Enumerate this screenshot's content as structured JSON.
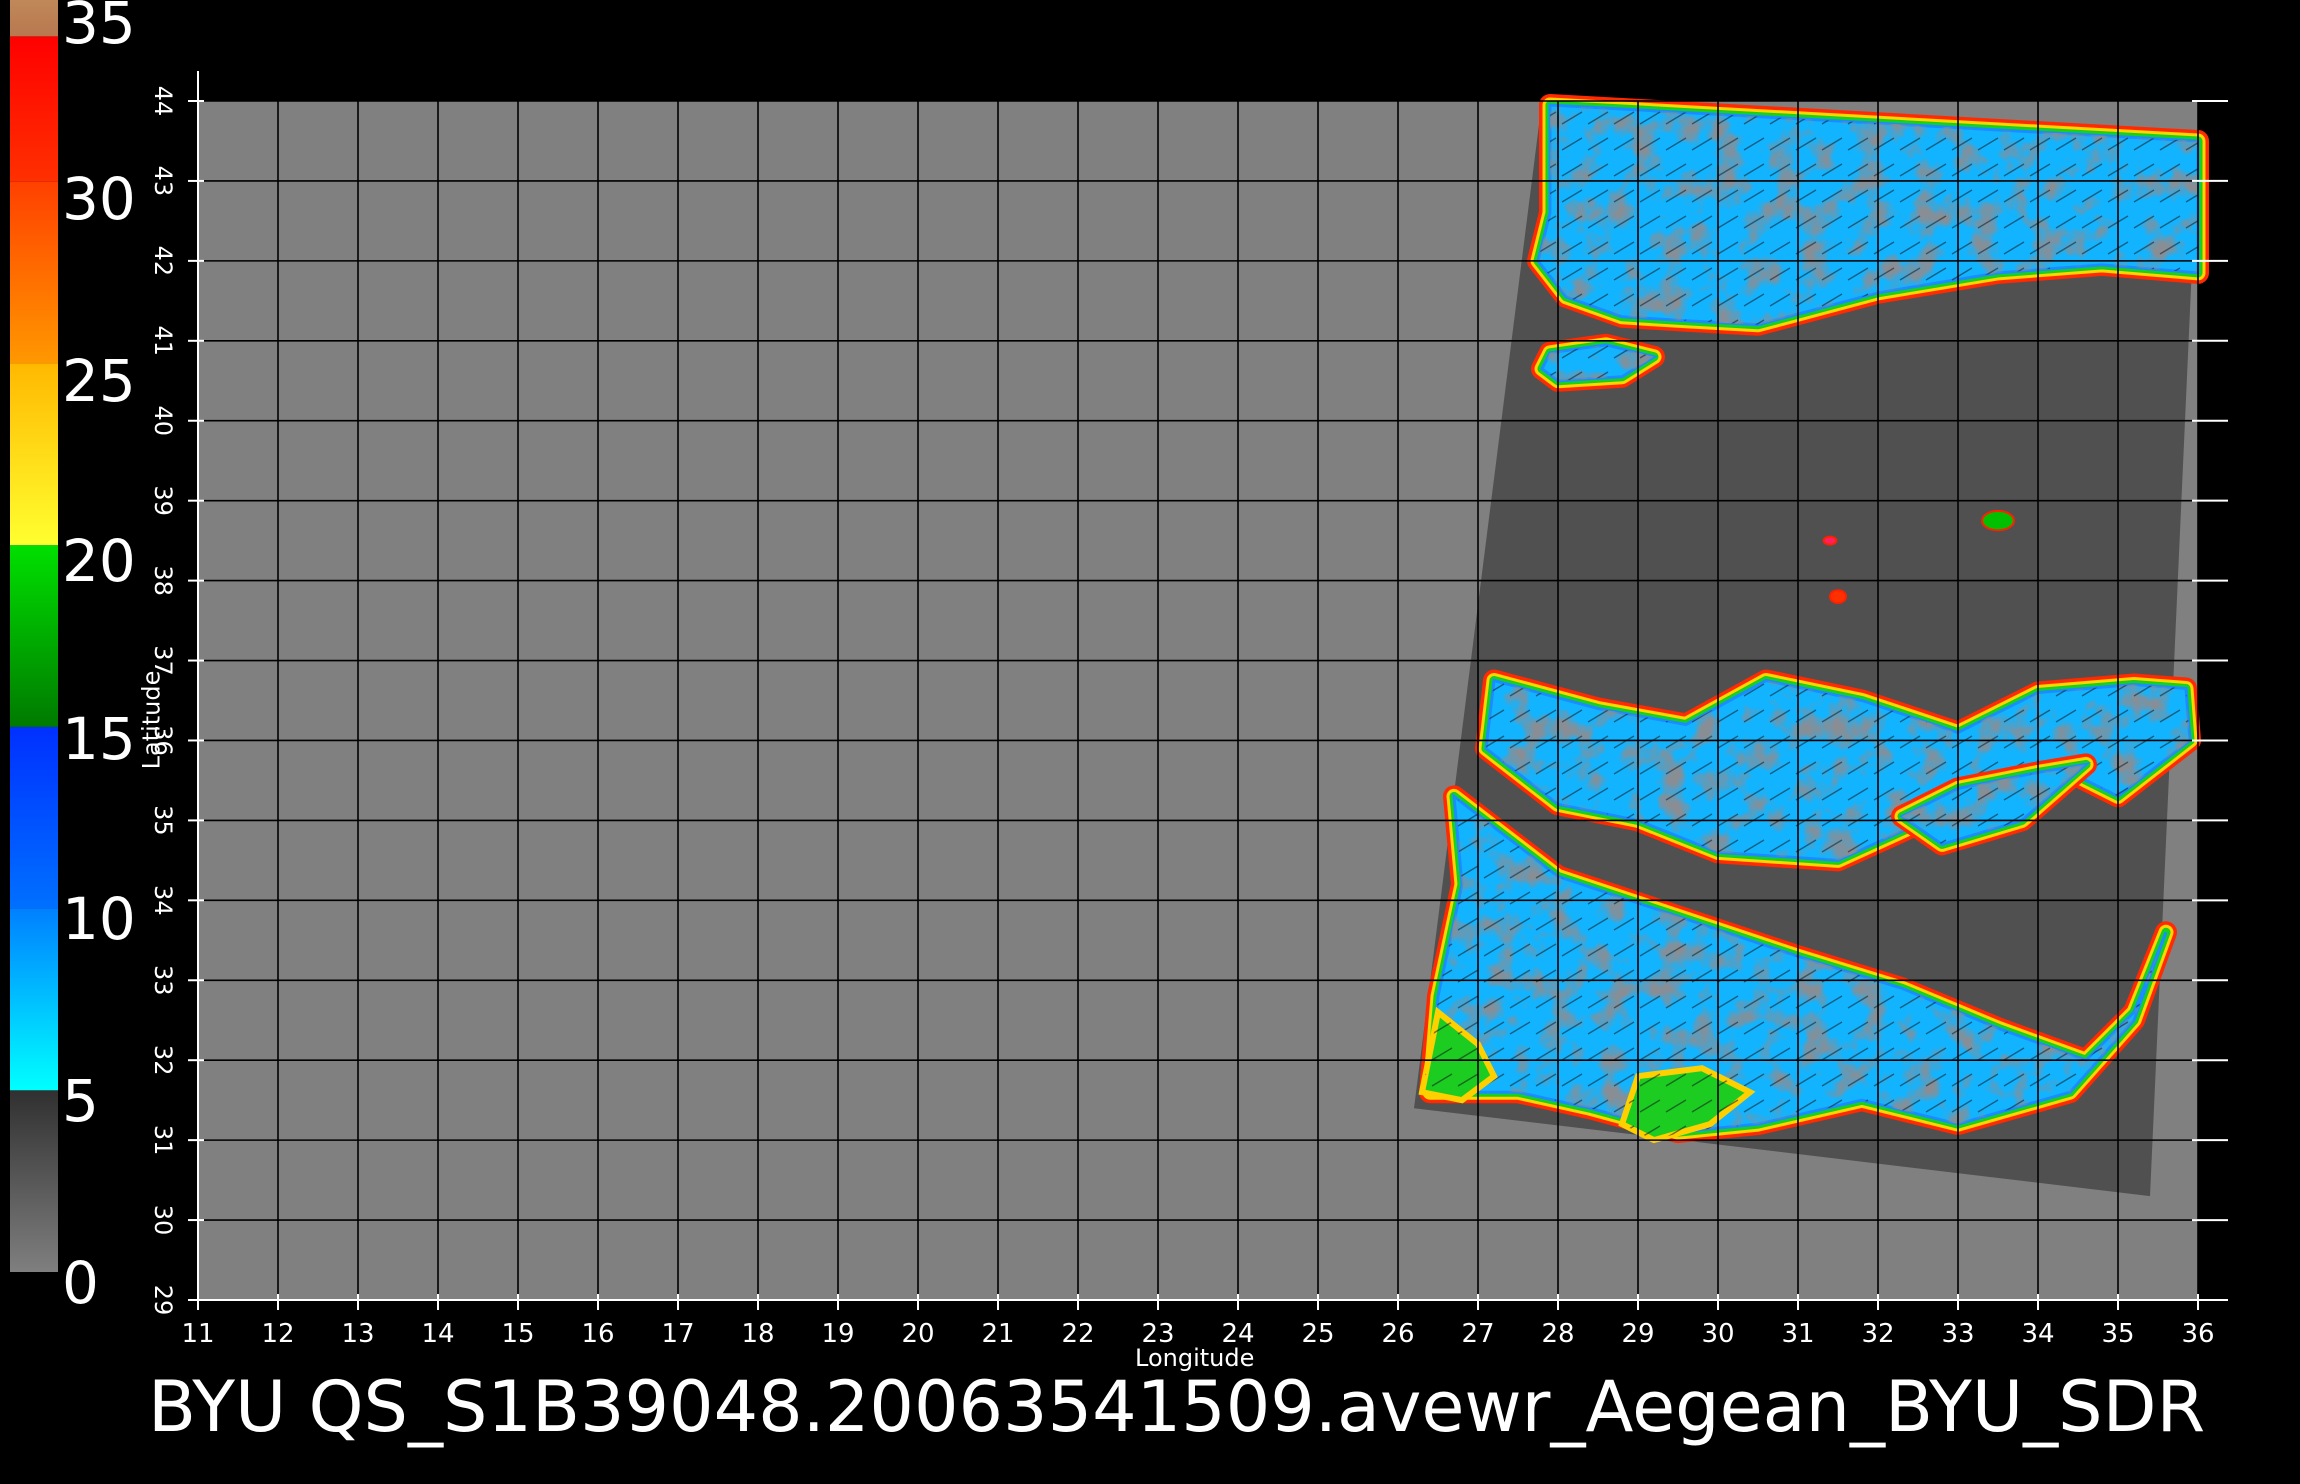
{
  "title": "BYU  QS_S1B39048.20063541509.avewr_Aegean_BYU_SDR",
  "colorbar": {
    "labels": [
      "35",
      "30",
      "25",
      "20",
      "15",
      "10",
      "5",
      "0"
    ],
    "segments": [
      {
        "from": 0,
        "to": 5,
        "colors": [
          "#7f7f7f",
          "#303030"
        ]
      },
      {
        "from": 5,
        "to": 10,
        "colors": [
          "#00ffff",
          "#0080ff"
        ]
      },
      {
        "from": 10,
        "to": 15,
        "colors": [
          "#0070ff",
          "#0030ff"
        ]
      },
      {
        "from": 15,
        "to": 20,
        "colors": [
          "#007a00",
          "#00e000"
        ]
      },
      {
        "from": 20,
        "to": 25,
        "colors": [
          "#ffff30",
          "#ffb800"
        ]
      },
      {
        "from": 25,
        "to": 30,
        "colors": [
          "#ff9800",
          "#ff4000"
        ]
      },
      {
        "from": 30,
        "to": 34,
        "colors": [
          "#ff3000",
          "#ff0000"
        ]
      },
      {
        "from": 34,
        "to": 35,
        "colors": [
          "#b87850",
          "#c08858"
        ]
      }
    ]
  },
  "map": {
    "x_axis_label": "Longitude",
    "y_axis_label": "Latitude",
    "x_ticks": [
      "11",
      "12",
      "13",
      "14",
      "15",
      "16",
      "17",
      "18",
      "19",
      "20",
      "21",
      "22",
      "23",
      "24",
      "25",
      "26",
      "27",
      "28",
      "29",
      "30",
      "31",
      "32",
      "33",
      "34",
      "35",
      "36"
    ],
    "y_ticks": [
      "29",
      "30",
      "31",
      "32",
      "33",
      "34",
      "35",
      "36",
      "37",
      "38",
      "39",
      "40",
      "41",
      "42",
      "43",
      "44"
    ],
    "x_range": [
      11,
      36
    ],
    "y_range": [
      29,
      44
    ],
    "background_color": "#808080",
    "swath_color": "#505050",
    "swath_corners": [
      [
        27.8,
        44.0
      ],
      [
        36.0,
        43.6
      ],
      [
        35.4,
        30.3
      ],
      [
        26.2,
        31.4
      ]
    ],
    "land_regions": [
      {
        "name": "balkans-anatolia-north",
        "polygon": [
          [
            27.9,
            43.95
          ],
          [
            36.0,
            43.5
          ],
          [
            36.0,
            41.85
          ],
          [
            34.8,
            41.95
          ],
          [
            33.5,
            41.85
          ],
          [
            32.0,
            41.6
          ],
          [
            30.5,
            41.2
          ],
          [
            29.6,
            41.25
          ],
          [
            28.8,
            41.3
          ],
          [
            28.1,
            41.55
          ],
          [
            27.75,
            42.0
          ],
          [
            27.9,
            42.6
          ]
        ]
      },
      {
        "name": "marmara-peninsula",
        "polygon": [
          [
            27.9,
            40.85
          ],
          [
            28.6,
            40.95
          ],
          [
            29.2,
            40.8
          ],
          [
            28.8,
            40.55
          ],
          [
            28.0,
            40.5
          ],
          [
            27.8,
            40.65
          ]
        ]
      },
      {
        "name": "anatolia-south",
        "polygon": [
          [
            27.2,
            36.75
          ],
          [
            28.5,
            36.4
          ],
          [
            29.6,
            36.2
          ],
          [
            30.6,
            36.75
          ],
          [
            31.8,
            36.5
          ],
          [
            33.0,
            36.1
          ],
          [
            34.0,
            36.6
          ],
          [
            35.2,
            36.7
          ],
          [
            35.85,
            36.65
          ],
          [
            35.9,
            36.0
          ],
          [
            35.0,
            35.3
          ],
          [
            34.2,
            35.7
          ],
          [
            33.5,
            35.6
          ],
          [
            32.6,
            35.0
          ],
          [
            31.5,
            34.5
          ],
          [
            30.0,
            34.6
          ],
          [
            29.0,
            35.0
          ],
          [
            28.0,
            35.2
          ],
          [
            27.1,
            35.9
          ]
        ]
      },
      {
        "name": "levant-egypt",
        "polygon": [
          [
            26.7,
            35.3
          ],
          [
            28.0,
            34.3
          ],
          [
            29.5,
            33.8
          ],
          [
            31.0,
            33.3
          ],
          [
            32.3,
            32.9
          ],
          [
            33.5,
            32.4
          ],
          [
            34.6,
            32.0
          ],
          [
            35.2,
            32.6
          ],
          [
            35.6,
            33.6
          ],
          [
            35.2,
            32.5
          ],
          [
            34.4,
            31.6
          ],
          [
            33.0,
            31.2
          ],
          [
            31.8,
            31.5
          ],
          [
            30.5,
            31.2
          ],
          [
            29.5,
            31.1
          ],
          [
            28.4,
            31.4
          ],
          [
            27.5,
            31.6
          ],
          [
            26.4,
            31.6
          ],
          [
            26.5,
            32.8
          ],
          [
            26.8,
            34.2
          ]
        ]
      },
      {
        "name": "cyprus",
        "polygon": [
          [
            32.3,
            35.05
          ],
          [
            33.0,
            35.4
          ],
          [
            34.0,
            35.6
          ],
          [
            34.6,
            35.7
          ],
          [
            33.8,
            35.0
          ],
          [
            32.8,
            34.7
          ]
        ]
      }
    ],
    "green_regions": [
      {
        "name": "libya-coast-green",
        "polygon": [
          [
            26.3,
            31.6
          ],
          [
            26.5,
            32.6
          ],
          [
            27.0,
            32.2
          ],
          [
            27.2,
            31.8
          ],
          [
            26.8,
            31.5
          ]
        ]
      },
      {
        "name": "nile-delta-green",
        "polygon": [
          [
            28.8,
            31.2
          ],
          [
            29.0,
            31.8
          ],
          [
            29.8,
            31.9
          ],
          [
            30.4,
            31.6
          ],
          [
            29.9,
            31.2
          ],
          [
            29.2,
            31.0
          ]
        ]
      }
    ],
    "islands": [
      {
        "name": "small-island-east",
        "center": [
          33.5,
          38.75
        ],
        "rx": 0.2,
        "ry": 0.12,
        "color": "#00c000"
      },
      {
        "name": "small-speck-1",
        "center": [
          31.4,
          38.5
        ],
        "rx": 0.08,
        "ry": 0.05,
        "color": "#ff2060"
      },
      {
        "name": "small-speck-2",
        "center": [
          31.5,
          37.8
        ],
        "rx": 0.1,
        "ry": 0.08,
        "color": "#ff3000"
      }
    ]
  }
}
